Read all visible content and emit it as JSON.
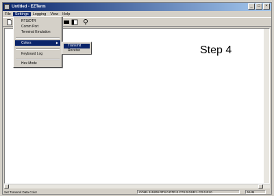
{
  "window": {
    "title": "Untitled - EZTerm",
    "min_glyph": "_",
    "max_glyph": "□",
    "close_glyph": "×"
  },
  "menubar": {
    "items": [
      "File",
      "Settings",
      "Logging",
      "View",
      "Help"
    ]
  },
  "settings_menu": {
    "items": [
      "RTS/DTR",
      "Comm Port",
      "Terminal Emulation",
      "Colors",
      "Keyboard Log",
      "Hex Mode"
    ],
    "submenu_arrow": "▶"
  },
  "colors_submenu": {
    "items": [
      "Transmit",
      "Receive"
    ]
  },
  "overlay": {
    "step_label": "Step 4"
  },
  "statusbar": {
    "message": "Set Transmit Data Color",
    "port_info": "COM1 115200 RTS:0 DTR:0 CTS:0 DSR:1 CD:0 RI:0",
    "num": "NUM"
  },
  "icons": {
    "new": "new-file-icon",
    "help": "help-icon"
  }
}
